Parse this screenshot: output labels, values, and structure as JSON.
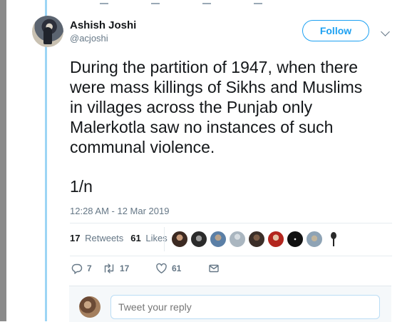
{
  "author": {
    "name": "Ashish Joshi",
    "handle": "@acjoshi"
  },
  "follow_label": "Follow",
  "tweet": {
    "text": "During the partition of 1947, when there\nwere mass killings of Sikhs and Muslims\nin villages across the Punjab only\nMalerkotla saw no instances of such\ncommunal violence.",
    "thread_marker": "1/n",
    "timestamp": "12:28 AM - 12 Mar 2019"
  },
  "stats": {
    "retweets_count": "17",
    "retweets_label": "Retweets",
    "likes_count": "61",
    "likes_label": "Likes"
  },
  "actions": {
    "reply_count": "7",
    "retweet_count": "17",
    "like_count": "61"
  },
  "reply": {
    "placeholder": "Tweet your reply"
  },
  "colors": {
    "accent": "#1da1f2",
    "thread_line": "#9dd5f5",
    "muted_text": "#657786"
  },
  "liker_avatars": [
    "avatar-1",
    "avatar-2",
    "avatar-3",
    "avatar-4",
    "avatar-5",
    "avatar-6",
    "avatar-7",
    "avatar-8",
    "avatar-9"
  ]
}
